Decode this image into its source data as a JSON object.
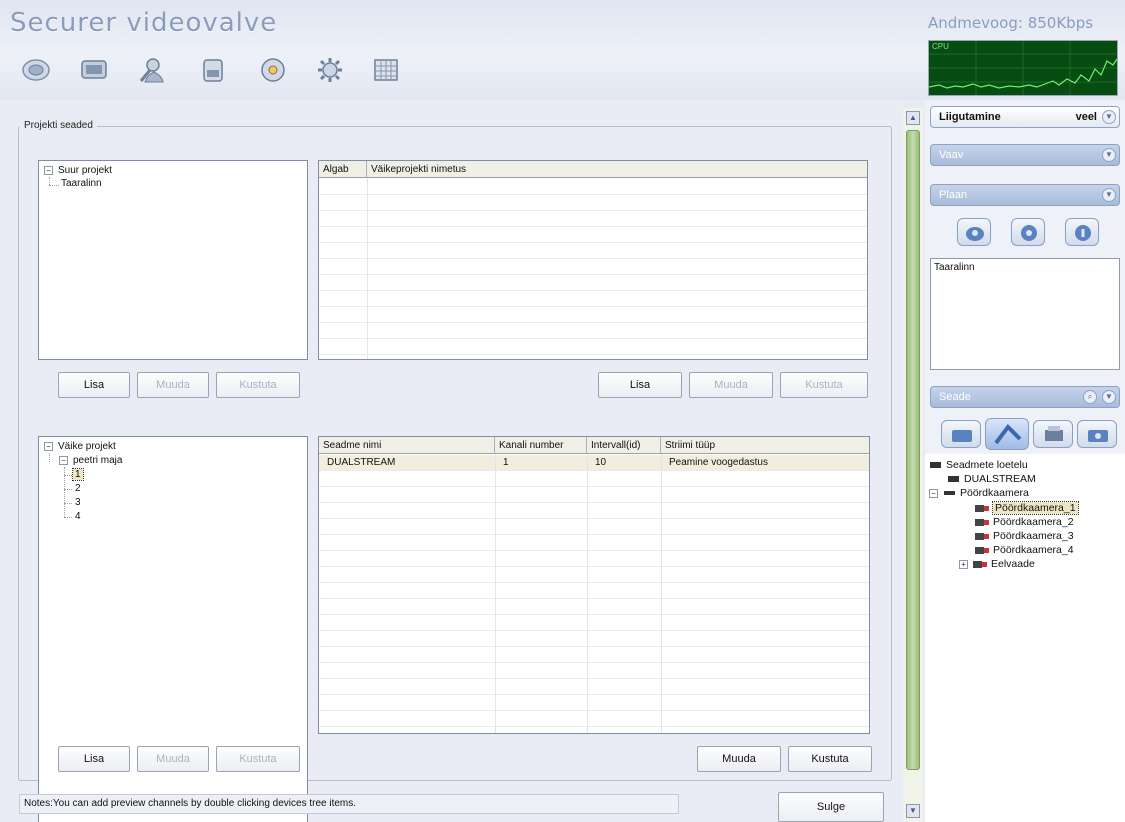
{
  "app": {
    "title": "Securer videovalve",
    "stream_rate": "Andmevoog: 850Kbps",
    "cpu_label": "CPU"
  },
  "toolbar": {
    "icons": [
      "camera-lens-icon",
      "monitor-icon",
      "search-user-icon",
      "storage-icon",
      "settings-disc-icon",
      "gear-icon",
      "calendar-grid-icon"
    ]
  },
  "project_settings": {
    "legend": "Projekti seaded",
    "big_project_tree": {
      "root": "Suur projekt",
      "children": [
        "Taaralinn"
      ]
    },
    "small_projects_grid": {
      "columns": [
        "Algab",
        "Väikeprojekti nimetus"
      ],
      "rows": []
    },
    "top_left_buttons": [
      "Lisa",
      "Muuda",
      "Kustuta"
    ],
    "top_right_buttons": [
      "Lisa",
      "Muuda",
      "Kustuta"
    ],
    "small_project_tree": {
      "root": "Väike projekt",
      "child": "peetri maja",
      "leaves": [
        "1",
        "2",
        "3",
        "4"
      ],
      "selected": "1"
    },
    "devices_grid": {
      "columns": [
        "Seadme nimi",
        "Kanali number",
        "Intervall(id)",
        "Striimi tüüp"
      ],
      "rows": [
        [
          "DUALSTREAM",
          "1",
          "10",
          "Peamine voogedastus"
        ]
      ]
    },
    "bottom_left_buttons": [
      "Lisa",
      "Muuda",
      "Kustuta"
    ],
    "bottom_right_buttons": [
      "Muuda",
      "Kustuta"
    ]
  },
  "footer": {
    "note": "Notes:You can add preview channels by double clicking devices tree items.",
    "close_label": "Sulge"
  },
  "right_panel": {
    "sections": [
      {
        "label": "Liigutamine",
        "extra": "veel",
        "active": true
      },
      {
        "label": "Vaav",
        "active": false
      },
      {
        "label": "Plaan",
        "active": false
      }
    ],
    "plan_list": [
      "Taaralinn"
    ],
    "devices_section": "Seade",
    "device_tree": {
      "root": "Seadmete loetelu",
      "dualstream": "DUALSTREAM",
      "group": "Pöördkaamera",
      "cameras": [
        "Pöördkaamera_1",
        "Pöördkaamera_2",
        "Pöördkaamera_3",
        "Pöördkaamera_4"
      ],
      "preview": "Eelvaade"
    }
  }
}
